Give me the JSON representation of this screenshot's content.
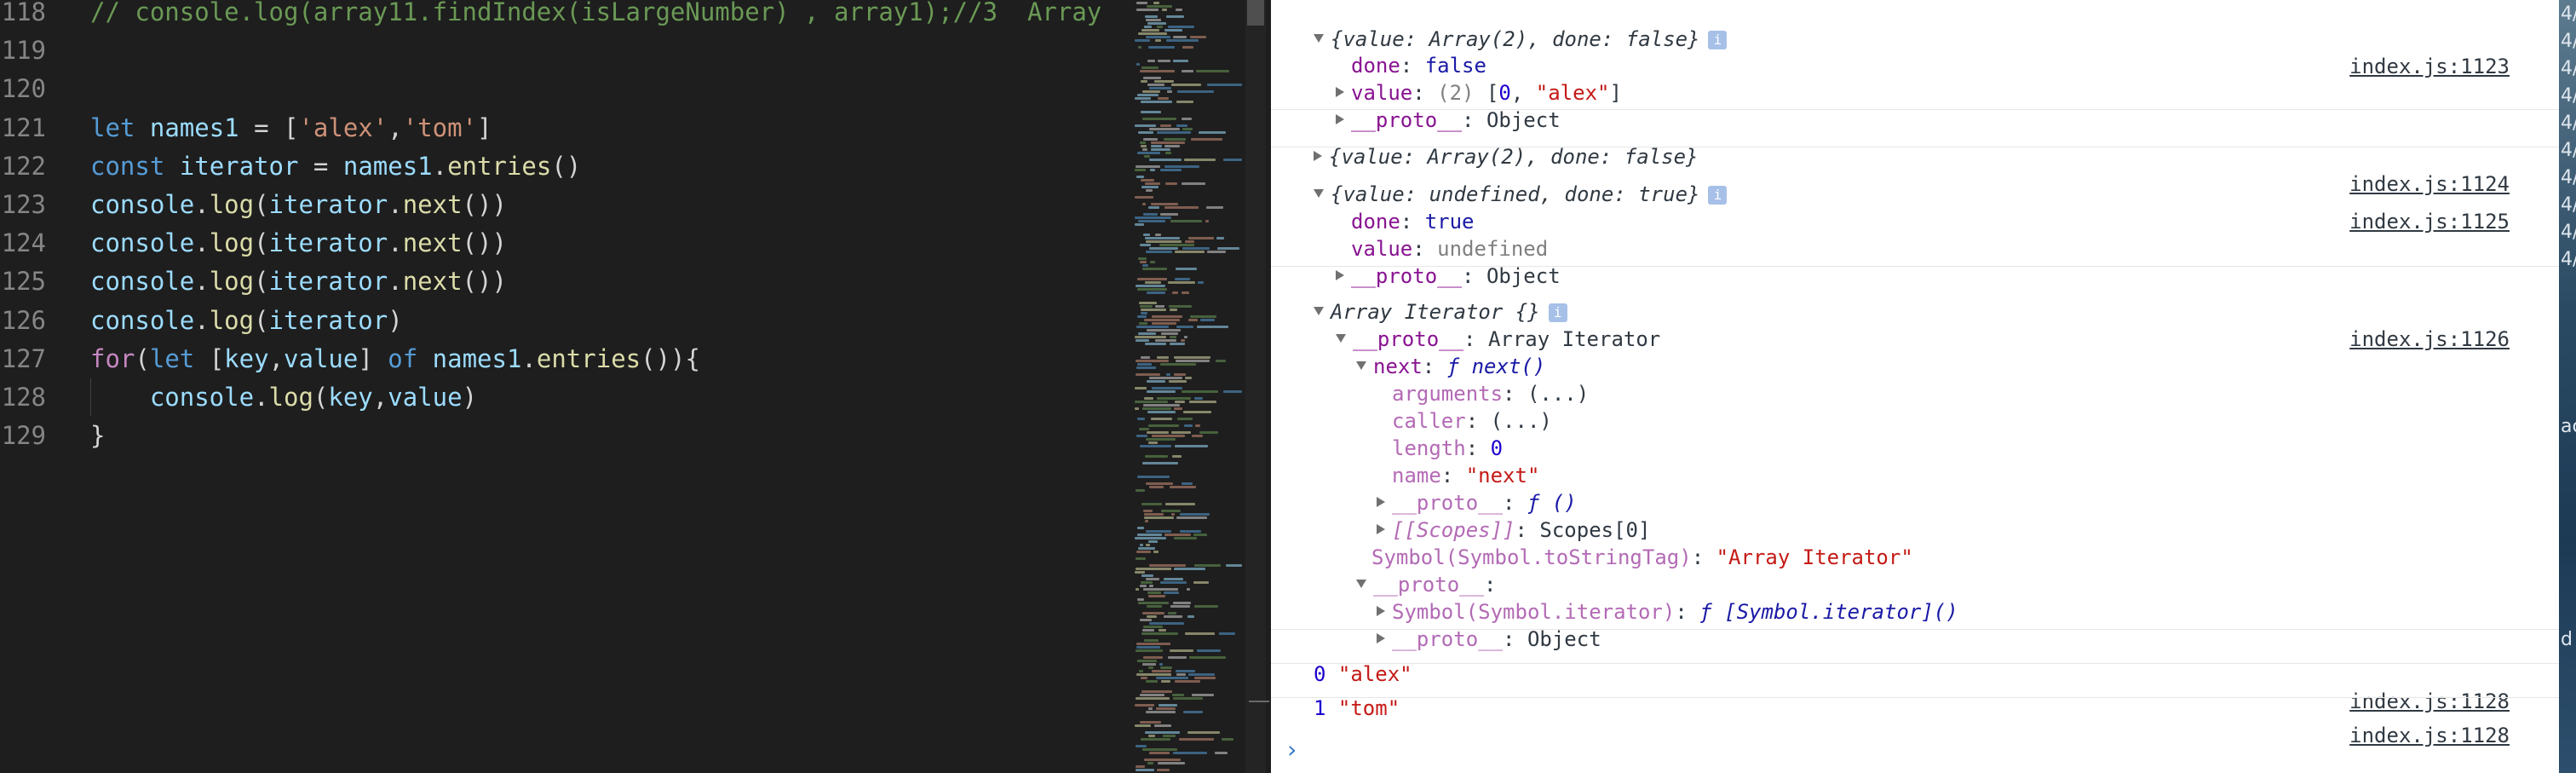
{
  "editor": {
    "lines": [
      {
        "num": "118",
        "tokens": [
          {
            "t": "// console.log(array11.findIndex(isLargeNumber) , array1);//3  Array",
            "c": "comment"
          }
        ]
      },
      {
        "num": "119",
        "tokens": []
      },
      {
        "num": "120",
        "tokens": []
      },
      {
        "num": "121",
        "tokens": [
          {
            "t": "let",
            "c": "keyword"
          },
          {
            "t": " ",
            "c": "plain"
          },
          {
            "t": "names1",
            "c": "var"
          },
          {
            "t": " = [",
            "c": "punct"
          },
          {
            "t": "'alex'",
            "c": "string"
          },
          {
            "t": ",",
            "c": "punct"
          },
          {
            "t": "'tom'",
            "c": "string"
          },
          {
            "t": "]",
            "c": "punct"
          }
        ]
      },
      {
        "num": "122",
        "tokens": [
          {
            "t": "const",
            "c": "keyword"
          },
          {
            "t": " ",
            "c": "plain"
          },
          {
            "t": "iterator",
            "c": "var"
          },
          {
            "t": " = ",
            "c": "punct"
          },
          {
            "t": "names1",
            "c": "var"
          },
          {
            "t": ".",
            "c": "punct"
          },
          {
            "t": "entries",
            "c": "func"
          },
          {
            "t": "()",
            "c": "punct"
          }
        ]
      },
      {
        "num": "123",
        "tokens": [
          {
            "t": "console",
            "c": "var"
          },
          {
            "t": ".",
            "c": "punct"
          },
          {
            "t": "log",
            "c": "func"
          },
          {
            "t": "(",
            "c": "punct"
          },
          {
            "t": "iterator",
            "c": "var"
          },
          {
            "t": ".",
            "c": "punct"
          },
          {
            "t": "next",
            "c": "func"
          },
          {
            "t": "())",
            "c": "punct"
          }
        ]
      },
      {
        "num": "124",
        "tokens": [
          {
            "t": "console",
            "c": "var"
          },
          {
            "t": ".",
            "c": "punct"
          },
          {
            "t": "log",
            "c": "func"
          },
          {
            "t": "(",
            "c": "punct"
          },
          {
            "t": "iterator",
            "c": "var"
          },
          {
            "t": ".",
            "c": "punct"
          },
          {
            "t": "next",
            "c": "func"
          },
          {
            "t": "())",
            "c": "punct"
          }
        ]
      },
      {
        "num": "125",
        "tokens": [
          {
            "t": "console",
            "c": "var"
          },
          {
            "t": ".",
            "c": "punct"
          },
          {
            "t": "log",
            "c": "func"
          },
          {
            "t": "(",
            "c": "punct"
          },
          {
            "t": "iterator",
            "c": "var"
          },
          {
            "t": ".",
            "c": "punct"
          },
          {
            "t": "next",
            "c": "func"
          },
          {
            "t": "())",
            "c": "punct"
          }
        ]
      },
      {
        "num": "126",
        "tokens": [
          {
            "t": "console",
            "c": "var"
          },
          {
            "t": ".",
            "c": "punct"
          },
          {
            "t": "log",
            "c": "func"
          },
          {
            "t": "(",
            "c": "punct"
          },
          {
            "t": "iterator",
            "c": "var"
          },
          {
            "t": ")",
            "c": "punct"
          }
        ]
      },
      {
        "num": "127",
        "tokens": [
          {
            "t": "for",
            "c": "control"
          },
          {
            "t": "(",
            "c": "punct"
          },
          {
            "t": "let",
            "c": "keyword"
          },
          {
            "t": " [",
            "c": "punct"
          },
          {
            "t": "key",
            "c": "var"
          },
          {
            "t": ",",
            "c": "punct"
          },
          {
            "t": "value",
            "c": "var"
          },
          {
            "t": "] ",
            "c": "punct"
          },
          {
            "t": "of",
            "c": "keyword"
          },
          {
            "t": " ",
            "c": "plain"
          },
          {
            "t": "names1",
            "c": "var"
          },
          {
            "t": ".",
            "c": "punct"
          },
          {
            "t": "entries",
            "c": "func"
          },
          {
            "t": "()){",
            "c": "punct"
          }
        ]
      },
      {
        "num": "128",
        "tokens": [
          {
            "t": "    ",
            "c": "plain"
          },
          {
            "t": "console",
            "c": "var"
          },
          {
            "t": ".",
            "c": "punct"
          },
          {
            "t": "log",
            "c": "func"
          },
          {
            "t": "(",
            "c": "punct"
          },
          {
            "t": "key",
            "c": "var"
          },
          {
            "t": ",",
            "c": "punct"
          },
          {
            "t": "value",
            "c": "var"
          },
          {
            "t": ")",
            "c": "punct"
          }
        ]
      },
      {
        "num": "129",
        "tokens": [
          {
            "t": "}",
            "c": "punct"
          }
        ]
      }
    ]
  },
  "console": {
    "entry1": {
      "summary": "{value: Array(2), done: false}",
      "source": "index.js:1123",
      "done_key": "done",
      "done_val": "false",
      "value_key": "value",
      "value_len": "(2)",
      "value_open": "[",
      "value_first": "0",
      "value_sep": ", ",
      "value_second": "\"alex\"",
      "value_close": "]",
      "proto_key": "__proto__",
      "proto_val": "Object"
    },
    "entry2": {
      "summary": "{value: Array(2), done: false}",
      "source": "index.js:1124"
    },
    "entry3": {
      "summary": "{value: undefined, done: true}",
      "source": "index.js:1125",
      "done_key": "done",
      "done_val": "true",
      "value_key": "value",
      "value_val": "undefined",
      "proto_key": "__proto__",
      "proto_val": "Object"
    },
    "entry4": {
      "summary": "Array Iterator {}",
      "source": "index.js:1126",
      "proto_key": "__proto__",
      "proto_val": "Array Iterator",
      "next_key": "next",
      "next_val": "ƒ next()",
      "arguments_key": "arguments",
      "arguments_val": "(...)",
      "caller_key": "caller",
      "caller_val": "(...)",
      "length_key": "length",
      "length_val": "0",
      "name_key": "name",
      "name_val": "\"next\"",
      "fn_proto_key": "__proto__",
      "fn_proto_val": "ƒ ()",
      "scopes_key": "[[Scopes]]",
      "scopes_val": "Scopes[0]",
      "tostringtag_key": "Symbol(Symbol.toStringTag)",
      "tostringtag_val": "\"Array Iterator\"",
      "inner_proto_key": "__proto__",
      "symbol_iter_key": "Symbol(Symbol.iterator)",
      "symbol_iter_val": "ƒ [Symbol.iterator]()",
      "inner_proto2_key": "__proto__",
      "inner_proto2_val": "Object"
    },
    "output1": {
      "index": "0",
      "value": "\"alex\"",
      "source": "index.js:1128"
    },
    "output2": {
      "index": "1",
      "value": "\"tom\"",
      "source": "index.js:1128"
    },
    "prompt": "›"
  },
  "desktop": {
    "glyphs": [
      "4/",
      "4/",
      "4/",
      "4/",
      "4/",
      "4/",
      "4/",
      "4/",
      "4/",
      "4/",
      "ac",
      "d"
    ]
  },
  "colors": {
    "editor_bg": "#1e1e1e",
    "console_bg": "#ffffff",
    "link": "#303942"
  }
}
